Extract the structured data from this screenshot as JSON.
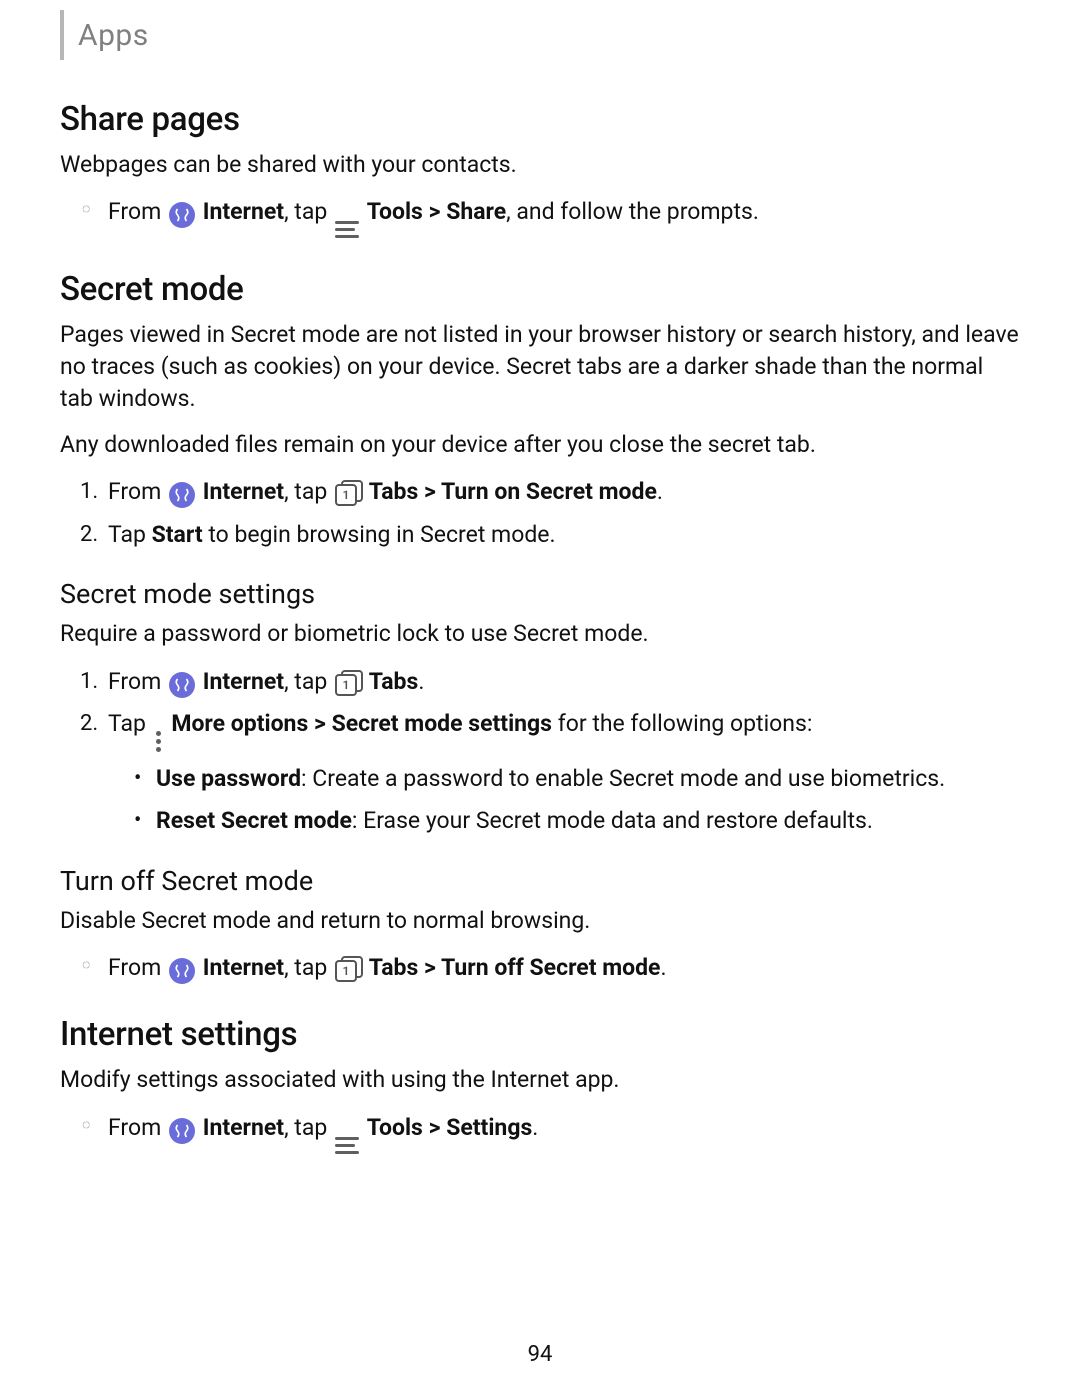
{
  "header": {
    "title": "Apps"
  },
  "pageNumber": "94",
  "s1": {
    "title": "Share pages",
    "intro": "Webpages can be shared with your contacts.",
    "step_from": "From",
    "step_app": "Internet",
    "step_tap": ", tap",
    "step_tools": "Tools",
    "step_gt": " > ",
    "step_share": "Share",
    "step_tail": ", and follow the prompts."
  },
  "s2": {
    "title": "Secret mode",
    "intro1": "Pages viewed in Secret mode are not listed in your browser history or search history, and leave no traces (such as cookies) on your device. Secret tabs are a darker shade than the normal tab windows.",
    "intro2": "Any downloaded files remain on your device after you close the secret tab.",
    "step1_from": "From",
    "step1_app": "Internet",
    "step1_tap": ", tap",
    "step1_tabs": "Tabs",
    "step1_action": "Turn on Secret mode",
    "step1_dot": ".",
    "step2_a": "Tap ",
    "step2_start": "Start",
    "step2_b": " to begin browsing in Secret mode."
  },
  "s2a": {
    "heading": "Secret mode settings",
    "intro": "Require a password or biometric lock to use Secret mode.",
    "step1_from": "From",
    "step1_app": "Internet",
    "step1_tap": ", tap",
    "step1_tabs": "Tabs",
    "step1_dot": ".",
    "step2_a": "Tap ",
    "step2_more": "More options",
    "step2_gt": " > ",
    "step2_sms": "Secret mode settings",
    "step2_b": " for the following options:",
    "sub1_label": "Use password",
    "sub1_text": ": Create a password to enable Secret mode and use biometrics.",
    "sub2_label": "Reset Secret mode",
    "sub2_text": ": Erase your Secret mode data and restore defaults."
  },
  "s2b": {
    "heading": "Turn off Secret mode",
    "intro": "Disable Secret mode and return to normal browsing.",
    "from": "From",
    "app": "Internet",
    "tap": ", tap",
    "tabs": "Tabs",
    "gt": " > ",
    "action": "Turn off Secret mode",
    "dot": "."
  },
  "s3": {
    "title": "Internet settings",
    "intro": "Modify settings associated with using the Internet app.",
    "from": "From",
    "app": "Internet",
    "tap": ", tap",
    "tools": "Tools",
    "gt": " > ",
    "settings": "Settings",
    "dot": "."
  }
}
